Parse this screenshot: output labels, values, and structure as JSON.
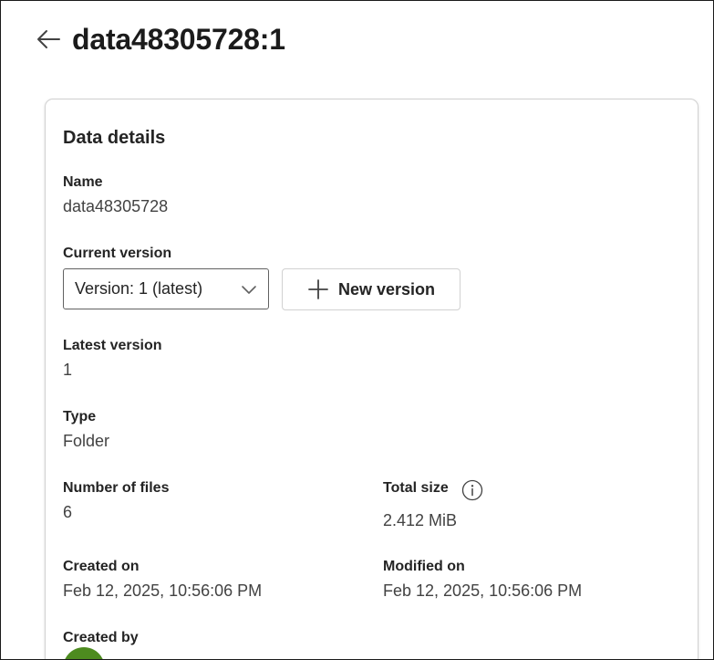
{
  "header": {
    "title": "data48305728:1"
  },
  "card": {
    "title": "Data details",
    "name_label": "Name",
    "name_value": "data48305728",
    "current_version_label": "Current version",
    "version_select_value": "Version: 1 (latest)",
    "new_version_label": "New version",
    "latest_version_label": "Latest version",
    "latest_version_value": "1",
    "type_label": "Type",
    "type_value": "Folder",
    "num_files_label": "Number of files",
    "num_files_value": "6",
    "total_size_label": "Total size",
    "total_size_value": "2.412 MiB",
    "created_on_label": "Created on",
    "created_on_value": "Feb 12, 2025, 10:56:06 PM",
    "modified_on_label": "Modified on",
    "modified_on_value": "Feb 12, 2025, 10:56:06 PM",
    "created_by_label": "Created by"
  },
  "icons": {
    "back": "arrow-left-icon",
    "dropdown": "chevron-down-icon",
    "add": "plus-icon",
    "info": "info-icon"
  },
  "colors": {
    "avatar": "#4d8b1f",
    "border": "#d1d1d1",
    "text": "#242424"
  }
}
